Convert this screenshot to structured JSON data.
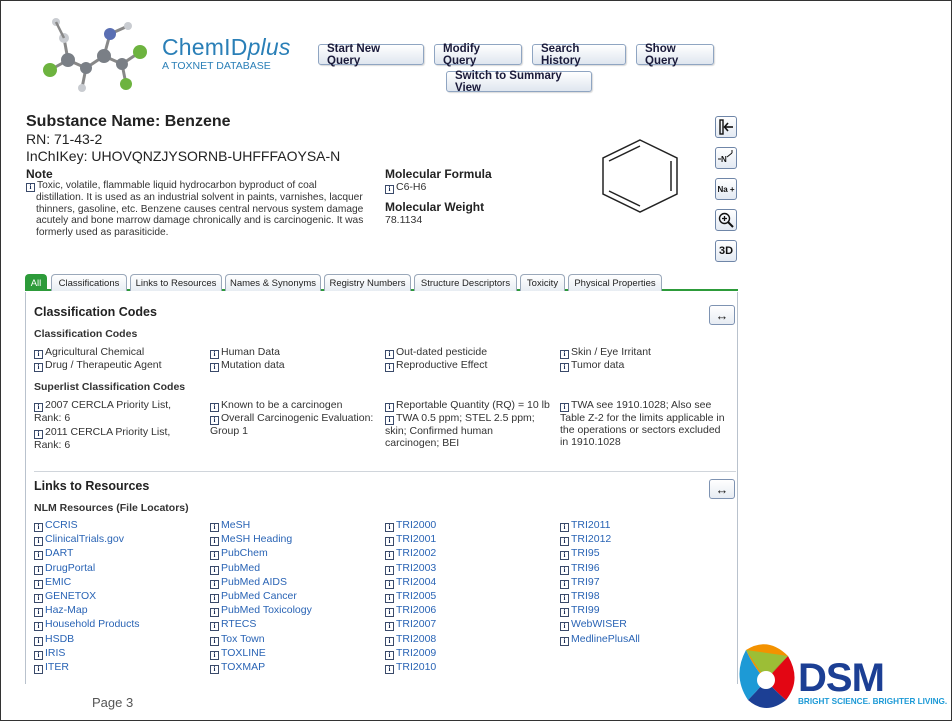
{
  "header": {
    "brand_prefix": "ChemID",
    "brand_suffix": "plus",
    "brand_sub": "A TOXNET DATABASE",
    "buttons": {
      "start": "Start New Query",
      "modify": "Modify Query",
      "history": "Search History",
      "show": "Show Query",
      "switch": "Switch to Summary View"
    }
  },
  "substance": {
    "title": "Substance Name: Benzene",
    "rn": "RN: 71-43-2",
    "inchikey": "InChIKey: UHOVQNZJYSORNB-UHFFFAOYSA-N",
    "note_label": "Note",
    "note_first": "Toxic, volatile, flammable liquid hydrocarbon byproduct of coal",
    "note_rest": "distillation. It is used as an industrial solvent in paints, varnishes, lacquer thinners, gasoline, etc. Benzene causes central nervous system damage acutely and bone marrow damage chronically and is carcinogenic. It was formerly used as parasiticide.",
    "mf_label": "Molecular Formula",
    "mf_value": "C6-H6",
    "mw_label": "Molecular Weight",
    "mw_value": "78.1134"
  },
  "tools": {
    "na": "Na +",
    "three_d": "3D"
  },
  "tabs": [
    "All",
    "Classifications",
    "Links to Resources",
    "Names & Synonyms",
    "Registry Numbers",
    "Structure Descriptors",
    "Toxicity",
    "Physical Properties"
  ],
  "classification": {
    "title": "Classification Codes",
    "sub1": "Classification Codes",
    "codes": [
      "Agricultural Chemical",
      "Drug / Therapeutic Agent",
      "Human Data",
      "Mutation data",
      "Out-dated pesticide",
      "Reproductive Effect",
      "Skin / Eye Irritant",
      "Tumor data"
    ],
    "sub2": "Superlist Classification Codes",
    "superlist": [
      "2007 CERCLA Priority List, Rank: 6",
      "2011 CERCLA Priority List, Rank: 6",
      "Known to be a carcinogen",
      "Overall Carcinogenic Evaluation: Group 1",
      "Reportable Quantity (RQ) = 10 lb",
      "TWA 0.5 ppm; STEL 2.5 ppm; skin; Confirmed human carcinogen; BEI",
      "TWA see 1910.1028; Also see Table Z-2 for the limits applicable in the operations or sectors excluded in 1910.1028"
    ]
  },
  "links": {
    "title": "Links to Resources",
    "sub": "NLM Resources (File Locators)",
    "col1": [
      "CCRIS",
      "ClinicalTrials.gov",
      "DART",
      "DrugPortal",
      "EMIC",
      "GENETOX",
      "Haz-Map",
      "Household Products",
      "HSDB",
      "IRIS",
      "ITER"
    ],
    "col2": [
      "MeSH",
      "MeSH Heading",
      "PubChem",
      "PubMed",
      "PubMed AIDS",
      "PubMed Cancer",
      "PubMed Toxicology",
      "RTECS",
      "Tox Town",
      "TOXLINE",
      "TOXMAP"
    ],
    "col3": [
      "TRI2000",
      "TRI2001",
      "TRI2002",
      "TRI2003",
      "TRI2004",
      "TRI2005",
      "TRI2006",
      "TRI2007",
      "TRI2008",
      "TRI2009",
      "TRI2010"
    ],
    "col4": [
      "TRI2011",
      "TRI2012",
      "TRI95",
      "TRI96",
      "TRI97",
      "TRI98",
      "TRI99",
      "WebWISER",
      "MedlinePlusAll"
    ]
  },
  "footer": {
    "page": "Page  3",
    "dsm": "DSM",
    "tagline": "BRIGHT SCIENCE. BRIGHTER LIVING."
  },
  "colors": {
    "brand": "#2a7fb7",
    "tab_active": "#2d9b3a",
    "link": "#2a64b5",
    "dsm_blue": "#1c3f94"
  }
}
